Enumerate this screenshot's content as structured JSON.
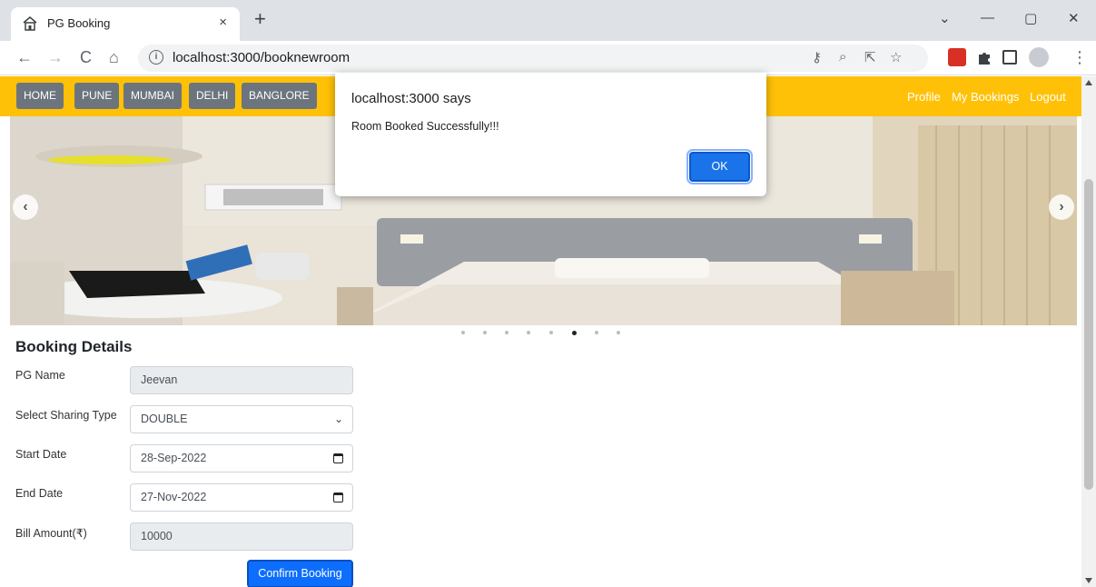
{
  "browser": {
    "tab_title": "PG Booking",
    "tab_close": "×",
    "new_tab": "+",
    "window_minimize": "—",
    "window_restore": "▢",
    "window_close": "✕",
    "window_dropdown": "⌄",
    "back": "←",
    "forward": "→",
    "reload": "C",
    "home": "⌂",
    "url": "localhost:3000/booknewroom",
    "omnibox_icons": [
      "key-icon",
      "zoom-icon",
      "share-icon",
      "star-icon"
    ],
    "menu": "⋮"
  },
  "navbar": {
    "color": "#ffc107",
    "left_items": [
      "HOME",
      "PUNE",
      "MUMBAI",
      "DELHI",
      "BANGLORE"
    ],
    "right_items": [
      "Profile",
      "My Bookings",
      "Logout"
    ]
  },
  "carousel": {
    "prev": "‹",
    "next": "›",
    "slide_count": 8,
    "active_slide": 6
  },
  "form": {
    "title": "Booking Details",
    "pg_name_label": "PG Name",
    "pg_name_value": "Jeevan",
    "sharing_label": "Select Sharing Type",
    "sharing_value": "DOUBLE",
    "start_label": "Start Date",
    "start_value": "28-Sep-2022",
    "end_label": "End Date",
    "end_value": "27-Nov-2022",
    "bill_label": "Bill Amount(₹)",
    "bill_value": "10000",
    "confirm_label": "Confirm Booking",
    "accent": "#0d6efd"
  },
  "dialog": {
    "title": "localhost:3000 says",
    "message": "Room Booked Successfully!!!",
    "ok_label": "OK"
  }
}
